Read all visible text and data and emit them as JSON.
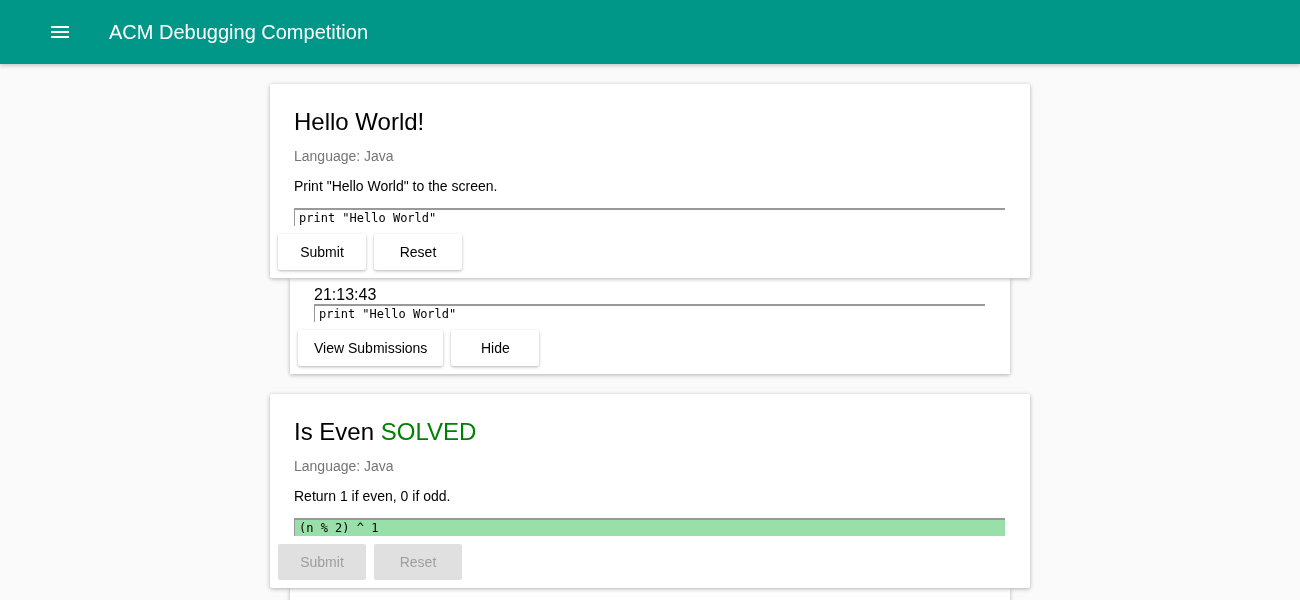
{
  "app_bar": {
    "title": "ACM Debugging Competition"
  },
  "problems": [
    {
      "title": "Hello World!",
      "solved": false,
      "language": "Language: Java",
      "description": "Print \"Hello World\" to the screen.",
      "code": "print \"Hello World\"",
      "buttons": [
        {
          "label": "Submit",
          "disabled": false
        },
        {
          "label": "Reset",
          "disabled": false
        }
      ],
      "expanded": true,
      "submission": {
        "time": "21:13:43",
        "code": "print \"Hello World\"",
        "buttons": [
          "View Submissions",
          "Hide"
        ]
      }
    },
    {
      "title": "Is Even",
      "solved": true,
      "status": "SOLVED",
      "language": "Language: Java",
      "description": "Return 1 if even, 0 if odd.",
      "code": "(n % 2) ^ 1",
      "buttons": [
        {
          "label": "Submit",
          "disabled": true
        },
        {
          "label": "Reset",
          "disabled": true
        }
      ],
      "expanded": true
    }
  ]
}
